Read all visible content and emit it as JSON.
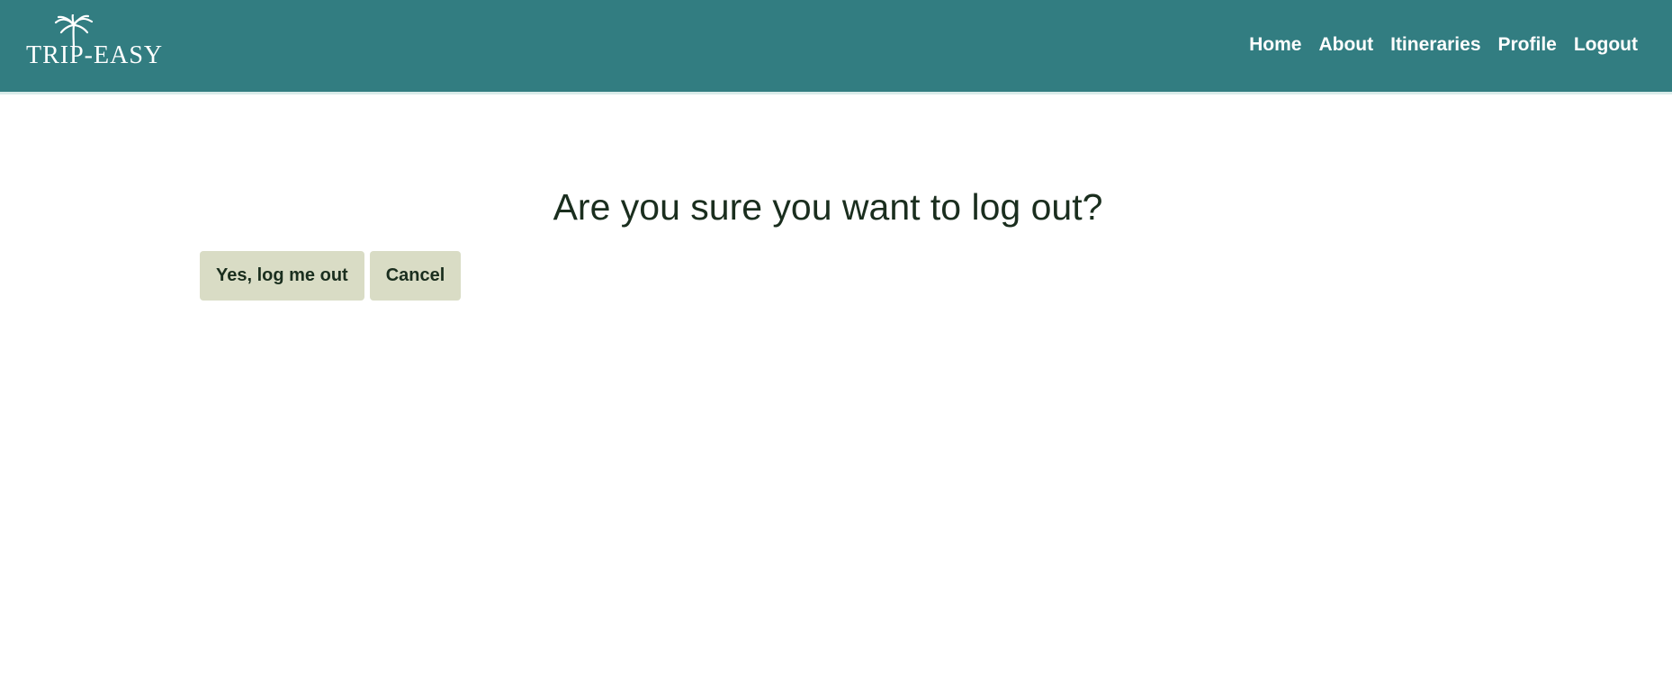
{
  "brand": {
    "logo_text": "TRIP-EASY",
    "logo_icon": "palm-tree-icon"
  },
  "nav": {
    "items": [
      {
        "label": "Home"
      },
      {
        "label": "About"
      },
      {
        "label": "Itineraries"
      },
      {
        "label": "Profile"
      },
      {
        "label": "Logout"
      }
    ]
  },
  "logout": {
    "question": "Are you sure you want to log out?",
    "confirm_label": "Yes, log me out",
    "cancel_label": "Cancel"
  },
  "colors": {
    "navbar_bg": "#327d81",
    "button_bg": "#d9dcc5",
    "text_dark": "#1a2e1e"
  }
}
